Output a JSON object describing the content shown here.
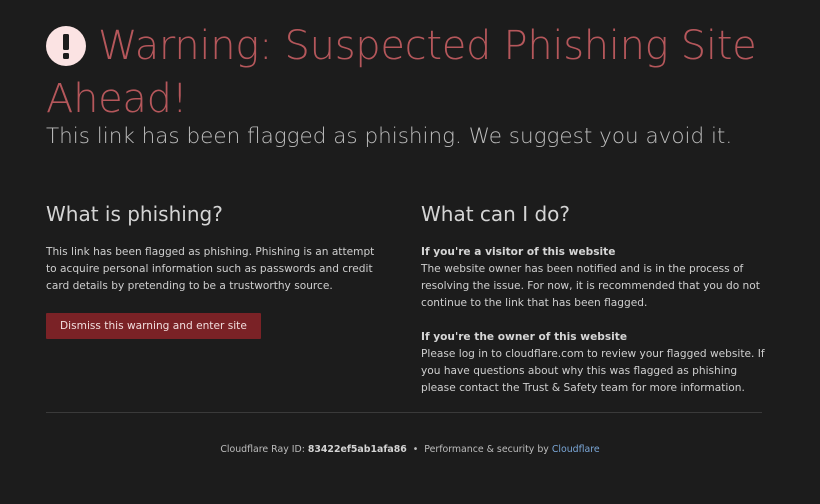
{
  "header": {
    "icon": "exclamation-icon",
    "title": "Warning: Suspected Phishing Site Ahead!",
    "subtitle": "This link has been flagged as phishing. We suggest you avoid it."
  },
  "left": {
    "heading": "What is phishing?",
    "text": "This link has been flagged as phishing. Phishing is an attempt to acquire personal information such as passwords and credit card details by pretending to be a trustworthy source.",
    "button_label": "Dismiss this warning and enter site"
  },
  "right": {
    "heading": "What can I do?",
    "visitor_heading": "If you're a visitor of this website",
    "visitor_text": "The website owner has been notified and is in the process of resolving the issue. For now, it is recommended that you do not continue to the link that has been flagged.",
    "owner_heading": "If you're the owner of this website",
    "owner_text": "Please log in to cloudflare.com to review your flagged website. If you have questions about why this was flagged as phishing please contact the Trust & Safety team for more information."
  },
  "footer": {
    "ray_label": "Cloudflare Ray ID:",
    "ray_id": "83422ef5ab1afa86",
    "separator": "•",
    "perf_label": "Performance & security by",
    "link_text": "Cloudflare"
  },
  "colors": {
    "background": "#1c1c1c",
    "title": "#b5575b",
    "button": "#7a2226",
    "link": "#7aa6d6"
  }
}
